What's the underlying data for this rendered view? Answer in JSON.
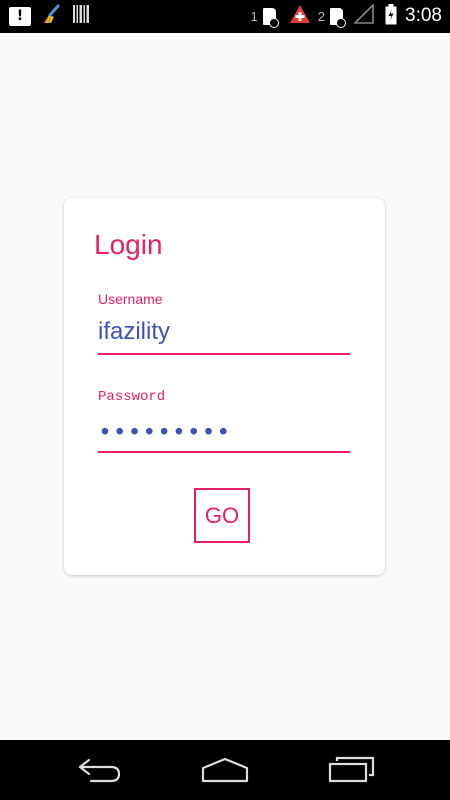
{
  "status_bar": {
    "alert_icon_glyph": "!",
    "sim1_label": "1",
    "sim2_label": "2",
    "time": "3:08"
  },
  "login": {
    "title": "Login",
    "username_label": "Username",
    "username_value": "ifazility",
    "password_label": "Password",
    "password_masked": "•••••••••",
    "go_label": "GO"
  },
  "icons": {
    "status_left": [
      "alert-icon",
      "broom-icon",
      "barcode-icon"
    ],
    "status_right": [
      "sim1-icon",
      "medical-cross-icon",
      "sim2-icon",
      "signal-icon",
      "battery-icon"
    ],
    "nav": [
      "back-icon",
      "home-icon",
      "recent-apps-icon"
    ]
  },
  "colors": {
    "accent": "#e91e63",
    "input_text": "#3f51b5",
    "background": "#fafafa",
    "bars": "#000000",
    "medical_badge": "#e53935"
  }
}
